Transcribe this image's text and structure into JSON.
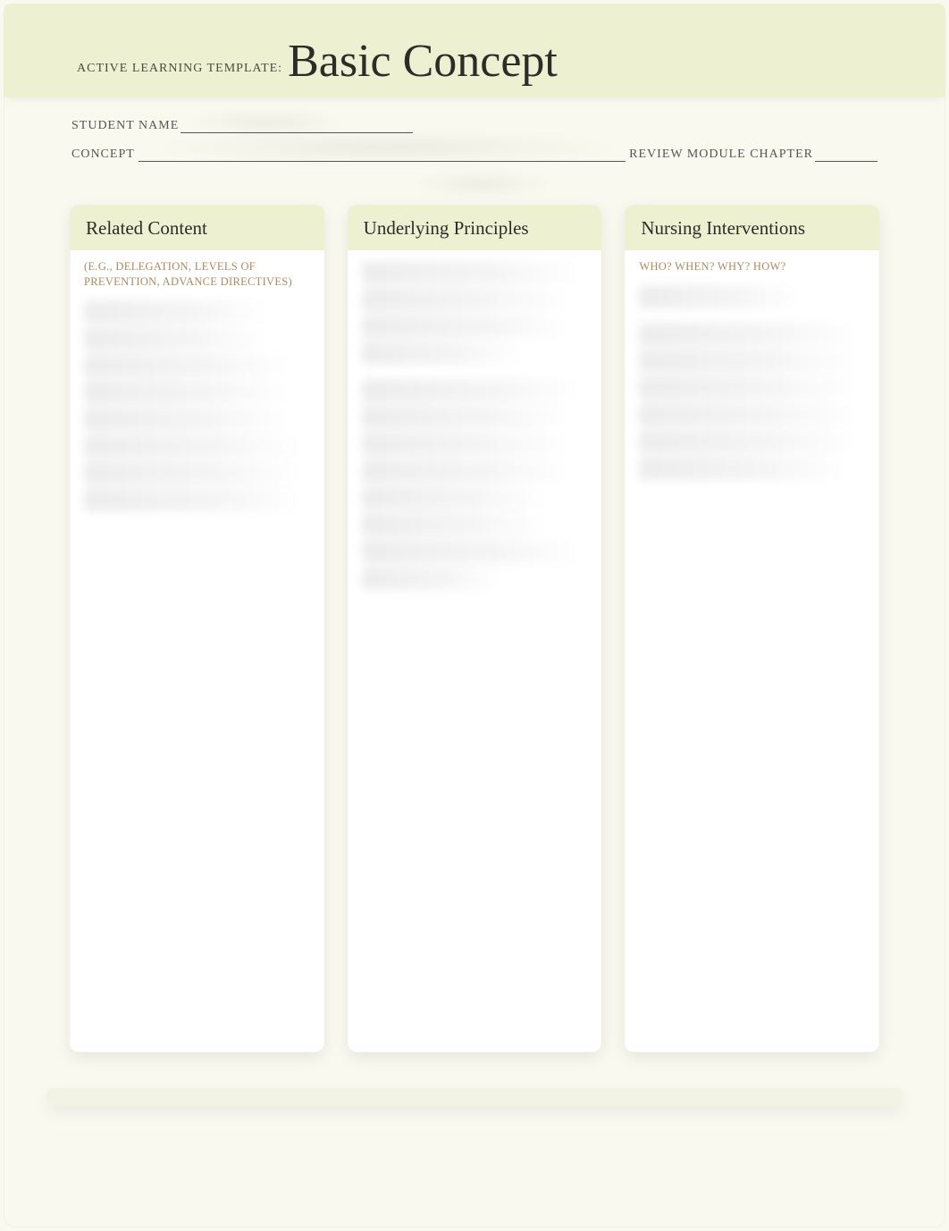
{
  "header": {
    "prefix": "ACTIVE LEARNING TEMPLATE:",
    "title": "Basic Concept"
  },
  "fields": {
    "student_name_label": "STUDENT NAME",
    "concept_label": "CONCEPT",
    "review_chapter_label": "REVIEW MODULE CHAPTER"
  },
  "columns": {
    "related": {
      "title": "Related Content",
      "subtitle": "(E.G., DELEGATION, LEVELS OF PREVENTION, ADVANCE DIRECTIVES)"
    },
    "principles": {
      "title": "Underlying Principles"
    },
    "interventions": {
      "title": "Nursing Interventions",
      "subtitle": "WHO? WHEN? WHY? HOW?"
    }
  }
}
